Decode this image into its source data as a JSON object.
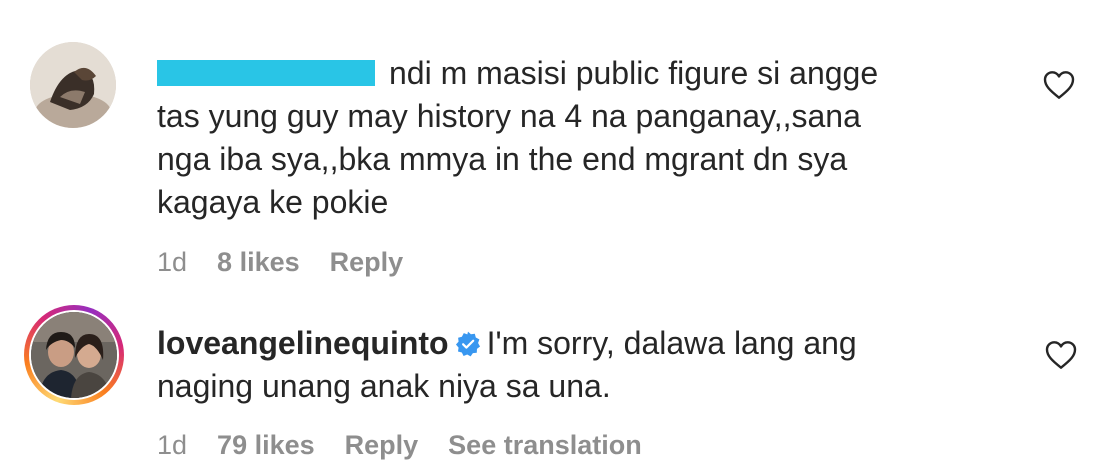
{
  "comments": [
    {
      "username": "",
      "text_line1": "ndi m masisi public figure si angge",
      "text_line2": "tas yung guy may history na 4 na panganay,,sana",
      "text_line3": "nga iba sya,,bka mmya in the end mgrant dn sya",
      "text_line4": "kagaya ke pokie",
      "time": "1d",
      "likes": "8 likes",
      "reply_label": "Reply",
      "liked": false
    },
    {
      "username": "loveangelinequinto",
      "verified": true,
      "text_line1": "I'm sorry, dalawa lang ang",
      "text_line2": "naging unang anak niya sa una.",
      "time": "1d",
      "likes": "79 likes",
      "reply_label": "Reply",
      "translation_label": "See translation",
      "liked": false
    }
  ],
  "colors": {
    "text": "#262626",
    "meta": "#8e8e8e",
    "verified": "#3897f0",
    "redaction": "#29c5e6"
  },
  "icons": {
    "like": "heart-outline-icon",
    "verified": "verified-badge-icon"
  }
}
